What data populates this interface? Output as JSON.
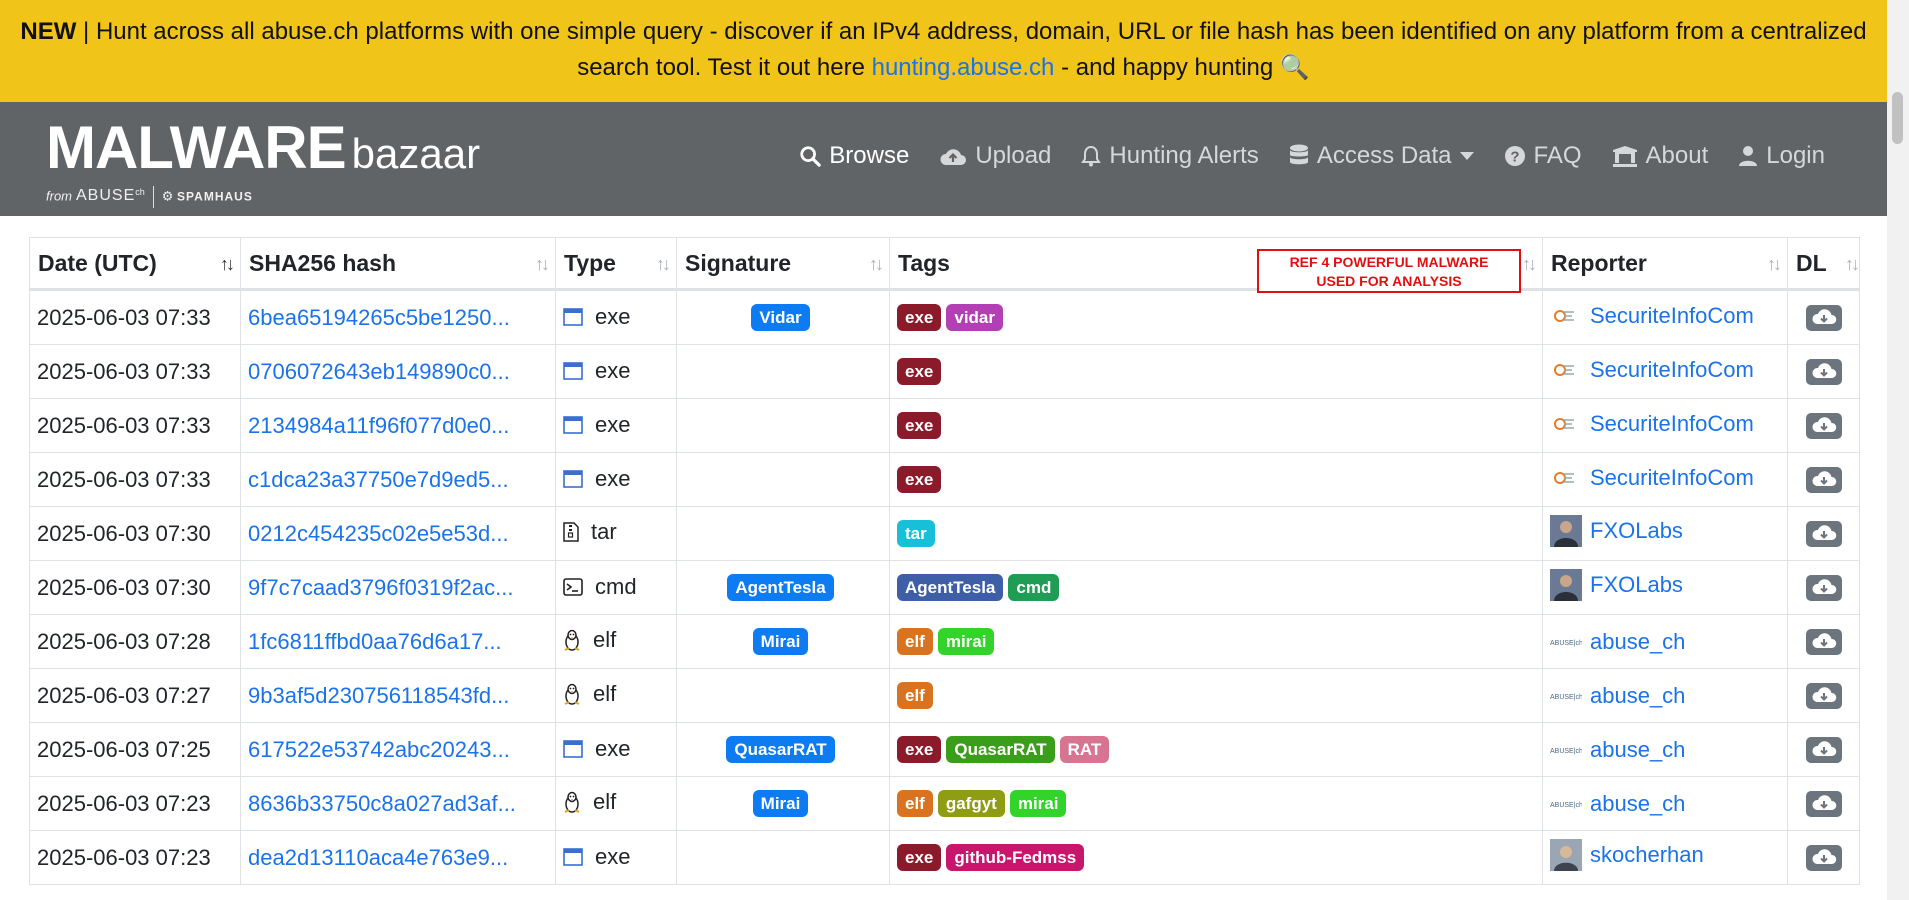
{
  "announcement": {
    "new_label": "NEW",
    "text_before": " | Hunt across all abuse.ch platforms with one simple query - discover if an IPv4 address, domain, URL or file hash has been identified on any platform from a centralized search tool. Test it out here ",
    "link_text": "hunting.abuse.ch",
    "text_after": " - and happy hunting 🔍"
  },
  "header": {
    "logo_main": "MALWARE",
    "logo_sub": "bazaar",
    "logo_from": "from",
    "logo_abuse": "ABUSE",
    "logo_abuse_sup": "ch",
    "logo_spamhaus": "SPAMHAUS",
    "nav": [
      {
        "label": "Browse",
        "icon": "search-icon"
      },
      {
        "label": "Upload",
        "icon": "cloud-upload-icon"
      },
      {
        "label": "Hunting Alerts",
        "icon": "bell-icon"
      },
      {
        "label": "Access Data",
        "icon": "database-icon"
      },
      {
        "label": "FAQ",
        "icon": "question-circle-icon"
      },
      {
        "label": "About",
        "icon": "building-icon"
      },
      {
        "label": "Login",
        "icon": "user-icon"
      }
    ]
  },
  "table": {
    "columns": [
      "Date (UTC)",
      "SHA256 hash",
      "Type",
      "Signature",
      "Tags",
      "Reporter",
      "DL"
    ],
    "rows": [
      {
        "date": "2025-06-03 07:33",
        "hash": "6bea65194265c5be1250...",
        "type": "exe",
        "signature": "Vidar",
        "tags": [
          "exe",
          "vidar"
        ],
        "reporter": "SecuriteInfoCom"
      },
      {
        "date": "2025-06-03 07:33",
        "hash": "0706072643eb149890c0...",
        "type": "exe",
        "signature": "",
        "tags": [
          "exe"
        ],
        "reporter": "SecuriteInfoCom"
      },
      {
        "date": "2025-06-03 07:33",
        "hash": "2134984a11f96f077d0e0...",
        "type": "exe",
        "signature": "",
        "tags": [
          "exe"
        ],
        "reporter": "SecuriteInfoCom"
      },
      {
        "date": "2025-06-03 07:33",
        "hash": "c1dca23a37750e7d9ed5...",
        "type": "exe",
        "signature": "",
        "tags": [
          "exe"
        ],
        "reporter": "SecuriteInfoCom"
      },
      {
        "date": "2025-06-03 07:30",
        "hash": "0212c454235c02e5e53d...",
        "type": "tar",
        "signature": "",
        "tags": [
          "tar"
        ],
        "reporter": "FXOLabs"
      },
      {
        "date": "2025-06-03 07:30",
        "hash": "9f7c7caad3796f0319f2ac...",
        "type": "cmd",
        "signature": "AgentTesla",
        "tags": [
          "AgentTesla",
          "cmd"
        ],
        "reporter": "FXOLabs"
      },
      {
        "date": "2025-06-03 07:28",
        "hash": "1fc6811ffbd0aa76d6a17...",
        "type": "elf",
        "signature": "Mirai",
        "tags": [
          "elf",
          "mirai"
        ],
        "reporter": "abuse_ch"
      },
      {
        "date": "2025-06-03 07:27",
        "hash": "9b3af5d230756118543fd...",
        "type": "elf",
        "signature": "",
        "tags": [
          "elf"
        ],
        "reporter": "abuse_ch"
      },
      {
        "date": "2025-06-03 07:25",
        "hash": "617522e53742abc20243...",
        "type": "exe",
        "signature": "QuasarRAT",
        "tags": [
          "exe",
          "QuasarRAT",
          "RAT"
        ],
        "reporter": "abuse_ch"
      },
      {
        "date": "2025-06-03 07:23",
        "hash": "8636b33750c8a027ad3af...",
        "type": "elf",
        "signature": "Mirai",
        "tags": [
          "elf",
          "gafgyt",
          "mirai"
        ],
        "reporter": "abuse_ch"
      },
      {
        "date": "2025-06-03 07:23",
        "hash": "dea2d13110aca4e763e9...",
        "type": "exe",
        "signature": "",
        "tags": [
          "exe",
          "github-Fedmss"
        ],
        "reporter": "skocherhan"
      }
    ]
  },
  "tag_colors": {
    "exe": "#8b1a2b",
    "vidar": "#b23fb3",
    "tar": "#17c0d8",
    "AgentTesla": "#3e5fa8",
    "cmd": "#1f9d55",
    "elf": "#d9731f",
    "mirai": "#33d42a",
    "QuasarRAT": "#3b9e1a",
    "RAT": "#d77491",
    "gafgyt": "#8e9d14",
    "github-Fedmss": "#c8166d"
  },
  "signature_color": "#0d7bf2",
  "overlay_note": {
    "line1": "REF 4 POWERFUL MALWARE",
    "line2": "USED FOR ANALYSIS"
  }
}
